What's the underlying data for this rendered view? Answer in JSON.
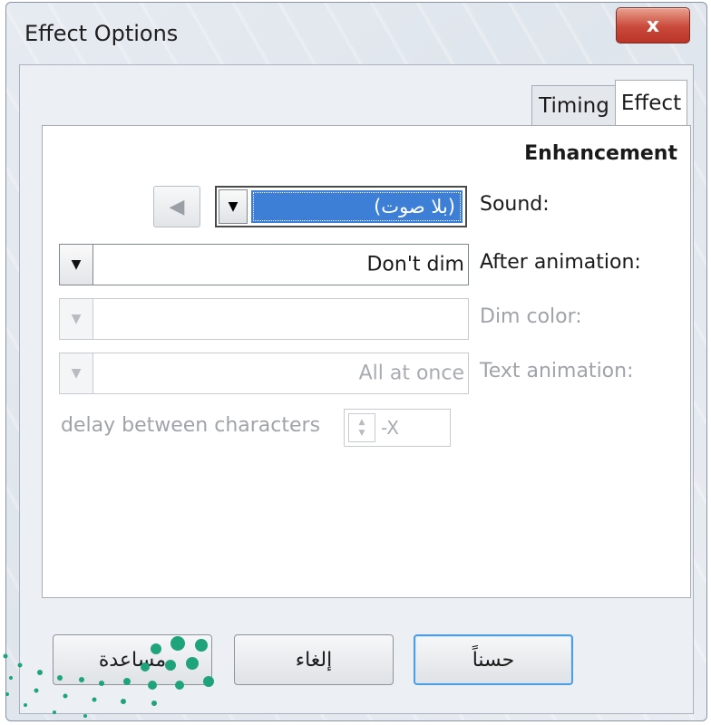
{
  "window": {
    "title": "Effect Options",
    "close_label": "x"
  },
  "tabs": [
    {
      "label": "Timing",
      "active": false
    },
    {
      "label": "Effect",
      "active": true
    }
  ],
  "enhancement": {
    "section_title": "Enhancement",
    "sound": {
      "label": "Sound:",
      "value": "(بلا صوت)"
    },
    "after_animation": {
      "label": "After animation:",
      "value": "Don't dim"
    },
    "dim_color": {
      "label": "Dim color:",
      "value": ""
    },
    "text_animation": {
      "label": "Text animation:",
      "value": "All at once"
    },
    "delay": {
      "label": "delay between characters",
      "value": "-X"
    }
  },
  "buttons": {
    "ok": "حسناً",
    "cancel": "إلغاء",
    "help": "مساعدة"
  },
  "colors": {
    "selection": "#3d7fd6",
    "close_button": "#c9493a",
    "default_button_border": "#4d9de0",
    "watermark": "#1fa37a"
  }
}
